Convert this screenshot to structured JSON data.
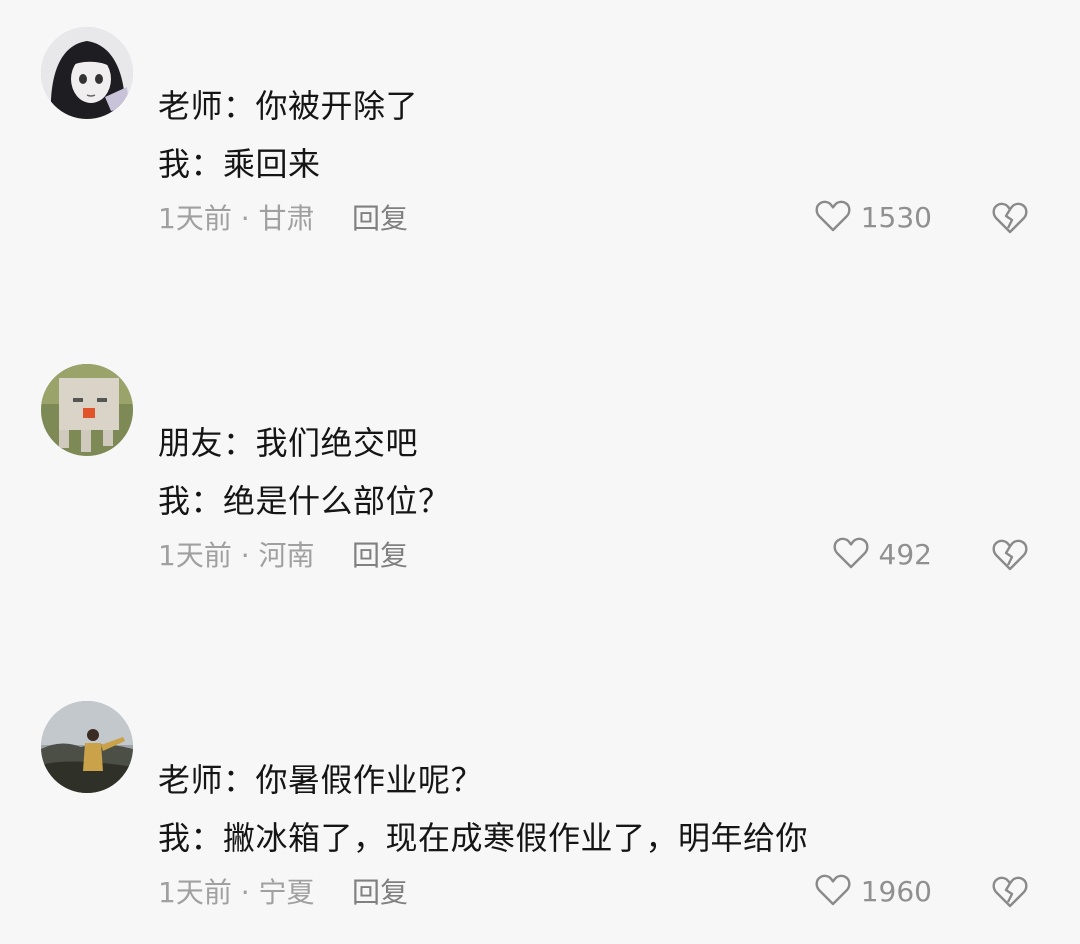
{
  "comments": [
    {
      "line1": "老师：你被开除了",
      "line2": "我：乘回来",
      "meta": "1天前 · 甘肃",
      "reply": "回复",
      "likes": "1530"
    },
    {
      "line1": "朋友：我们绝交吧",
      "line2": "我：绝是什么部位？",
      "meta": "1天前 · 河南",
      "reply": "回复",
      "likes": "492"
    },
    {
      "line1": "老师：你暑假作业呢？",
      "line2": "我：撇冰箱了，现在成寒假作业了，明年给你",
      "meta": "1天前 · 宁夏",
      "reply": "回复",
      "likes": "1960"
    }
  ],
  "icons": {
    "like": "heart-outline-icon",
    "dislike": "broken-heart-icon"
  },
  "colors": {
    "background": "#f7f7f7",
    "text": "#151515",
    "meta": "#a0a0a0",
    "icon": "#8a8a8a"
  }
}
